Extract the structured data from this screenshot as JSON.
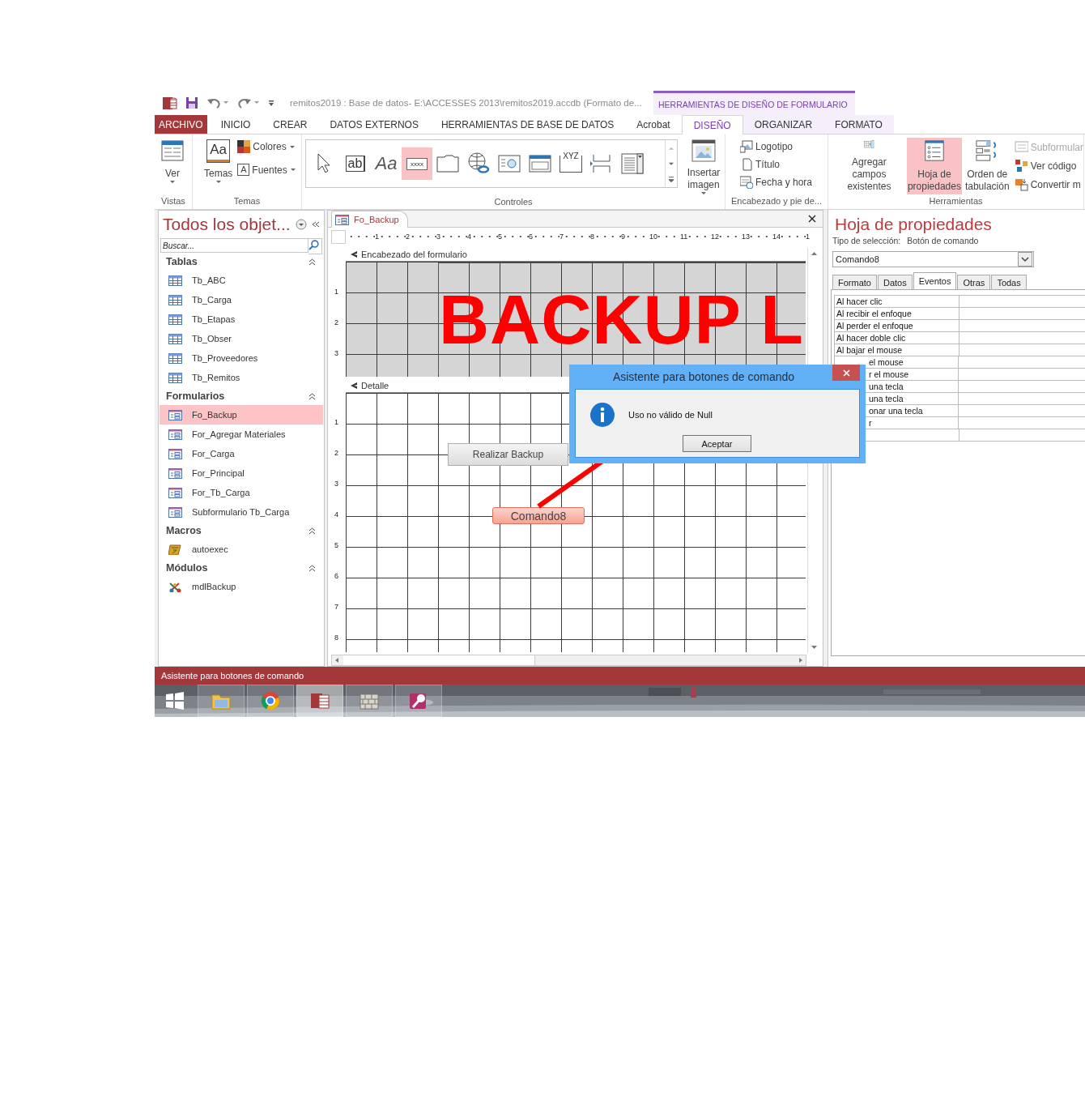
{
  "title_bar": {
    "title": "remitos2019 : Base de datos- E:\\ACCESSES 2013\\remitos2019.accdb (Formato de...",
    "context_header": "HERRAMIENTAS DE DISEÑO DE FORMULARIO"
  },
  "ribbon_tabs": [
    {
      "label": "ARCHIVO",
      "kind": "file",
      "selected": false
    },
    {
      "label": "INICIO",
      "kind": "normal",
      "selected": false
    },
    {
      "label": "CREAR",
      "kind": "normal",
      "selected": false
    },
    {
      "label": "DATOS EXTERNOS",
      "kind": "normal",
      "selected": false
    },
    {
      "label": "HERRAMIENTAS DE BASE DE DATOS",
      "kind": "normal",
      "selected": false
    },
    {
      "label": "Acrobat",
      "kind": "normal",
      "selected": false
    },
    {
      "label": "DISEÑO",
      "kind": "context",
      "selected": true
    },
    {
      "label": "ORGANIZAR",
      "kind": "context",
      "selected": false
    },
    {
      "label": "FORMATO",
      "kind": "context",
      "selected": false
    }
  ],
  "ribbon": {
    "vistas": {
      "label": "Vistas",
      "button": "Ver"
    },
    "temas": {
      "label": "Temas",
      "themes_glyph": "Aa",
      "themes_button": "Temas",
      "colors": "Colores",
      "fonts_glyph": "A",
      "fonts": "Fuentes"
    },
    "controles": {
      "label": "Controles",
      "insert_image": "Insertar\nimagen",
      "items": [
        {
          "kind": "pointer",
          "selected": false
        },
        {
          "kind": "textbox",
          "glyph": "ab",
          "selected": false
        },
        {
          "kind": "label",
          "glyph": "Aa",
          "selected": false
        },
        {
          "kind": "button",
          "glyph": "xxxx",
          "selected": true
        },
        {
          "kind": "tab",
          "selected": false
        },
        {
          "kind": "hyperlink",
          "selected": false
        },
        {
          "kind": "webbrowser",
          "selected": false
        },
        {
          "kind": "navigation",
          "selected": false
        },
        {
          "kind": "optiongroup",
          "glyph": "XYZ",
          "selected": false
        },
        {
          "kind": "pagebreak",
          "selected": false
        },
        {
          "kind": "combo",
          "selected": false
        }
      ]
    },
    "encabezado": {
      "label": "Encabezado y pie de...",
      "items": [
        {
          "kind": "logo",
          "label": "Logotipo"
        },
        {
          "kind": "title",
          "label": "Título"
        },
        {
          "kind": "datetime",
          "label": "Fecha y hora"
        }
      ]
    },
    "herramientas": {
      "label": "Herramientas",
      "buttons": [
        {
          "kind": "fields",
          "label": "Agregar campos\nexistentes",
          "selected": false
        },
        {
          "kind": "sheet",
          "label": "Hoja de\npropiedades",
          "selected": true
        },
        {
          "kind": "taborder",
          "label": "Orden de\ntabulación",
          "selected": false
        }
      ],
      "small": [
        {
          "kind": "subform",
          "label": "Subformular",
          "disabled": true
        },
        {
          "kind": "code",
          "label": "Ver código",
          "disabled": false
        },
        {
          "kind": "convert",
          "label": "Convertir m",
          "disabled": false
        }
      ]
    }
  },
  "navigation": {
    "title": "Todos los objet...",
    "search_placeholder": "Buscar...",
    "groups": [
      {
        "label": "Tablas",
        "kind": "table",
        "expanded": true,
        "items": [
          {
            "label": "Tb_ABC",
            "selected": false
          },
          {
            "label": "Tb_Carga",
            "selected": false
          },
          {
            "label": "Tb_Etapas",
            "selected": false
          },
          {
            "label": "Tb_Obser",
            "selected": false
          },
          {
            "label": "Tb_Proveedores",
            "selected": false
          },
          {
            "label": "Tb_Remitos",
            "selected": false
          }
        ]
      },
      {
        "label": "Formularios",
        "kind": "form",
        "expanded": true,
        "items": [
          {
            "label": "Fo_Backup",
            "selected": true
          },
          {
            "label": "For_Agregar Materiales",
            "selected": false
          },
          {
            "label": "For_Carga",
            "selected": false
          },
          {
            "label": "For_Principal",
            "selected": false
          },
          {
            "label": "For_Tb_Carga",
            "selected": false
          },
          {
            "label": "Subformulario Tb_Carga",
            "selected": false
          }
        ]
      },
      {
        "label": "Macros",
        "kind": "macro",
        "expanded": true,
        "items": [
          {
            "label": "autoexec",
            "selected": false
          }
        ]
      },
      {
        "label": "Módulos",
        "kind": "module",
        "expanded": true,
        "items": [
          {
            "label": "mdlBackup",
            "selected": false
          }
        ]
      }
    ]
  },
  "designer": {
    "tab": "Fo_Backup",
    "ruler_h": [
      "1",
      "2",
      "3",
      "4",
      "5",
      "6",
      "7",
      "8",
      "9",
      "10",
      "11",
      "12",
      "13",
      "14",
      "1"
    ],
    "sections": [
      {
        "label": "Encabezado del formulario",
        "kind": "header",
        "ruler_v": [
          "1",
          "2",
          "3"
        ],
        "controls": [
          {
            "kind": "label",
            "text": "BACKUP L"
          }
        ]
      },
      {
        "label": "Detalle",
        "kind": "detail",
        "ruler_v": [
          "1",
          "2",
          "3",
          "4",
          "5",
          "6",
          "7",
          "8"
        ],
        "controls": [
          {
            "kind": "button",
            "text": "Realizar Backup",
            "selected": false
          },
          {
            "kind": "button",
            "text": "Comando8",
            "selected": true
          }
        ]
      }
    ]
  },
  "property_sheet": {
    "title": "Hoja de propiedades",
    "selection_label": "Tipo de selección:",
    "selection_type": "Botón de comando",
    "object": "Comando8",
    "tabs": [
      {
        "label": "Formato",
        "selected": false
      },
      {
        "label": "Datos",
        "selected": false
      },
      {
        "label": "Eventos",
        "selected": true
      },
      {
        "label": "Otras",
        "selected": false
      },
      {
        "label": "Todas",
        "selected": false
      }
    ],
    "rows": [
      {
        "label": "Al hacer clic",
        "covered": false
      },
      {
        "label": "Al recibir el enfoque",
        "covered": false
      },
      {
        "label": "Al perder el enfoque",
        "covered": false
      },
      {
        "label": "Al hacer doble clic",
        "covered": false
      },
      {
        "label": "Al bajar el mouse",
        "covered": false
      },
      {
        "label": "el mouse",
        "covered": true
      },
      {
        "label": "r el mouse",
        "covered": true
      },
      {
        "label": "una tecla",
        "covered": true
      },
      {
        "label": "una tecla",
        "covered": true
      },
      {
        "label": "onar una tecla",
        "covered": true
      },
      {
        "label": "r",
        "covered": true
      }
    ]
  },
  "dialog": {
    "title": "Asistente para botones de comando",
    "message": "Uso no válido de Null",
    "button": "Aceptar"
  },
  "annotation_arrow": true,
  "status_bar": {
    "text": "Asistente para botones de comando"
  },
  "taskbar": {
    "apps": [
      {
        "kind": "start",
        "selected": false
      },
      {
        "kind": "explorer",
        "selected": false
      },
      {
        "kind": "browser",
        "selected": false
      },
      {
        "kind": "access",
        "selected": true
      },
      {
        "kind": "wall",
        "selected": false
      },
      {
        "kind": "accesskey",
        "selected": false
      }
    ]
  }
}
